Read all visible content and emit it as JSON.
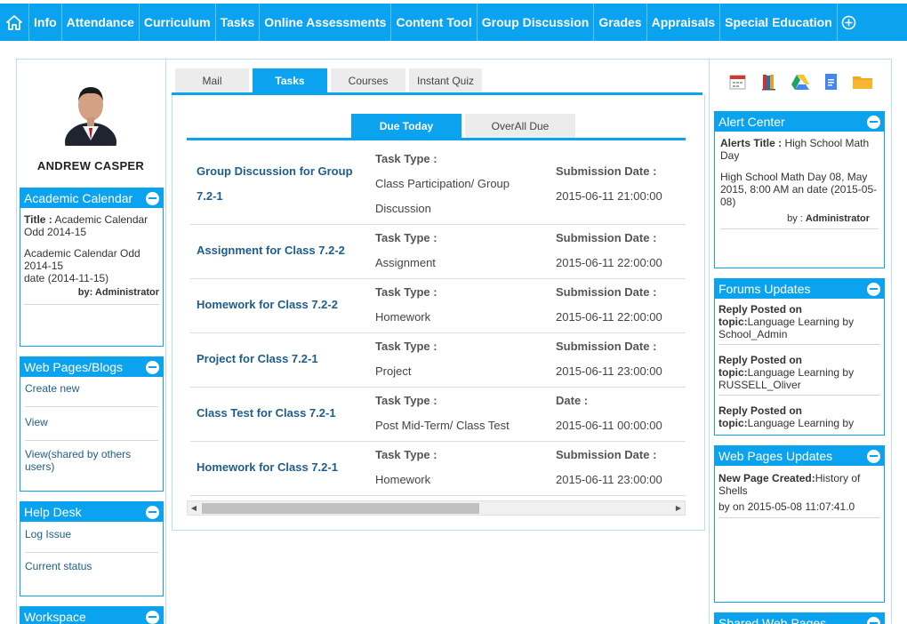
{
  "nav": {
    "items": [
      "Info",
      "Attendance",
      "Curriculum",
      "Tasks",
      "Online Assessments",
      "Content Tool",
      "Group Discussion",
      "Grades",
      "Appraisals",
      "Special Education"
    ]
  },
  "profile": {
    "name": "ANDREW  CASPER"
  },
  "academic_calendar": {
    "header": "Academic Calendar",
    "title_label": "Title :",
    "title_value": " Academic Calendar Odd 2014-15",
    "desc_line1": "Academic Calendar Odd 2014-15",
    "desc_line2": "date (2014-11-15)",
    "by": "by: Administrator"
  },
  "web_pages_blogs": {
    "header": "Web Pages/Blogs",
    "links": [
      "Create new",
      "View",
      "View(shared by others users)"
    ]
  },
  "help_desk": {
    "header": "Help Desk",
    "links": [
      "Log Issue",
      "Current status"
    ]
  },
  "workspace": {
    "header": "Workspace"
  },
  "tabs": [
    "Mail",
    "Tasks",
    "Courses",
    "Instant Quiz"
  ],
  "subtabs": [
    "Due Today",
    "OverAll Due"
  ],
  "tasks": [
    {
      "name": "Group Discussion for Group 7.2-1",
      "type_label": "Task Type :",
      "type": "Class Participation/ Group Discussion",
      "date_label": "Submission Date :",
      "date": "2015-06-11 21:00:00"
    },
    {
      "name": "Assignment for Class 7.2-2",
      "type_label": "Task Type :",
      "type": "Assignment",
      "date_label": "Submission Date :",
      "date": "2015-06-11 22:00:00"
    },
    {
      "name": "Homework for Class 7.2-2",
      "type_label": "Task Type :",
      "type": "Homework",
      "date_label": "Submission Date :",
      "date": "2015-06-11 22:00:00"
    },
    {
      "name": "Project for Class 7.2-1",
      "type_label": "Task Type :",
      "type": "Project",
      "date_label": "Submission Date :",
      "date": "2015-06-11 23:00:00"
    },
    {
      "name": "Class Test for Class 7.2-1",
      "type_label": "Task Type :",
      "type": "Post Mid-Term/ Class Test",
      "date_label": "Date :",
      "date": "2015-06-11 00:00:00"
    },
    {
      "name": "Homework for Class 7.2-1",
      "type_label": "Task Type :",
      "type": "Homework",
      "date_label": "Submission Date :",
      "date": "2015-06-11 23:00:00"
    }
  ],
  "quick_icons": [
    "calendar-icon",
    "books-icon",
    "drive-icon",
    "docs-icon",
    "folder-icon"
  ],
  "alert_center": {
    "header": "Alert Center",
    "title_label": "Alerts Title :",
    "title_value": " High School Math Day",
    "body": "High School Math Day 08, May 2015, 8:00 AM an date (2015-05-08)",
    "by_label": "by : ",
    "by_value": "Administrator"
  },
  "forums_updates": {
    "header": "Forums Updates",
    "posts": [
      {
        "head": "Reply Posted on",
        "topic_label": "topic:",
        "topic": "Language Learning by School_Admin"
      },
      {
        "head": "Reply Posted on",
        "topic_label": "topic:",
        "topic": "Language Learning by RUSSELL_Oliver"
      },
      {
        "head": "Reply Posted on",
        "topic_label": "topic:",
        "topic": "Language Learning by"
      }
    ]
  },
  "web_pages_updates": {
    "header": "Web Pages Updates",
    "created_label": "New Page Created:",
    "created_value": "History of Shells",
    "by": "by on 2015-05-08 11:07:41.0"
  },
  "shared_web_pages": {
    "header": "Shared Web Pages"
  }
}
